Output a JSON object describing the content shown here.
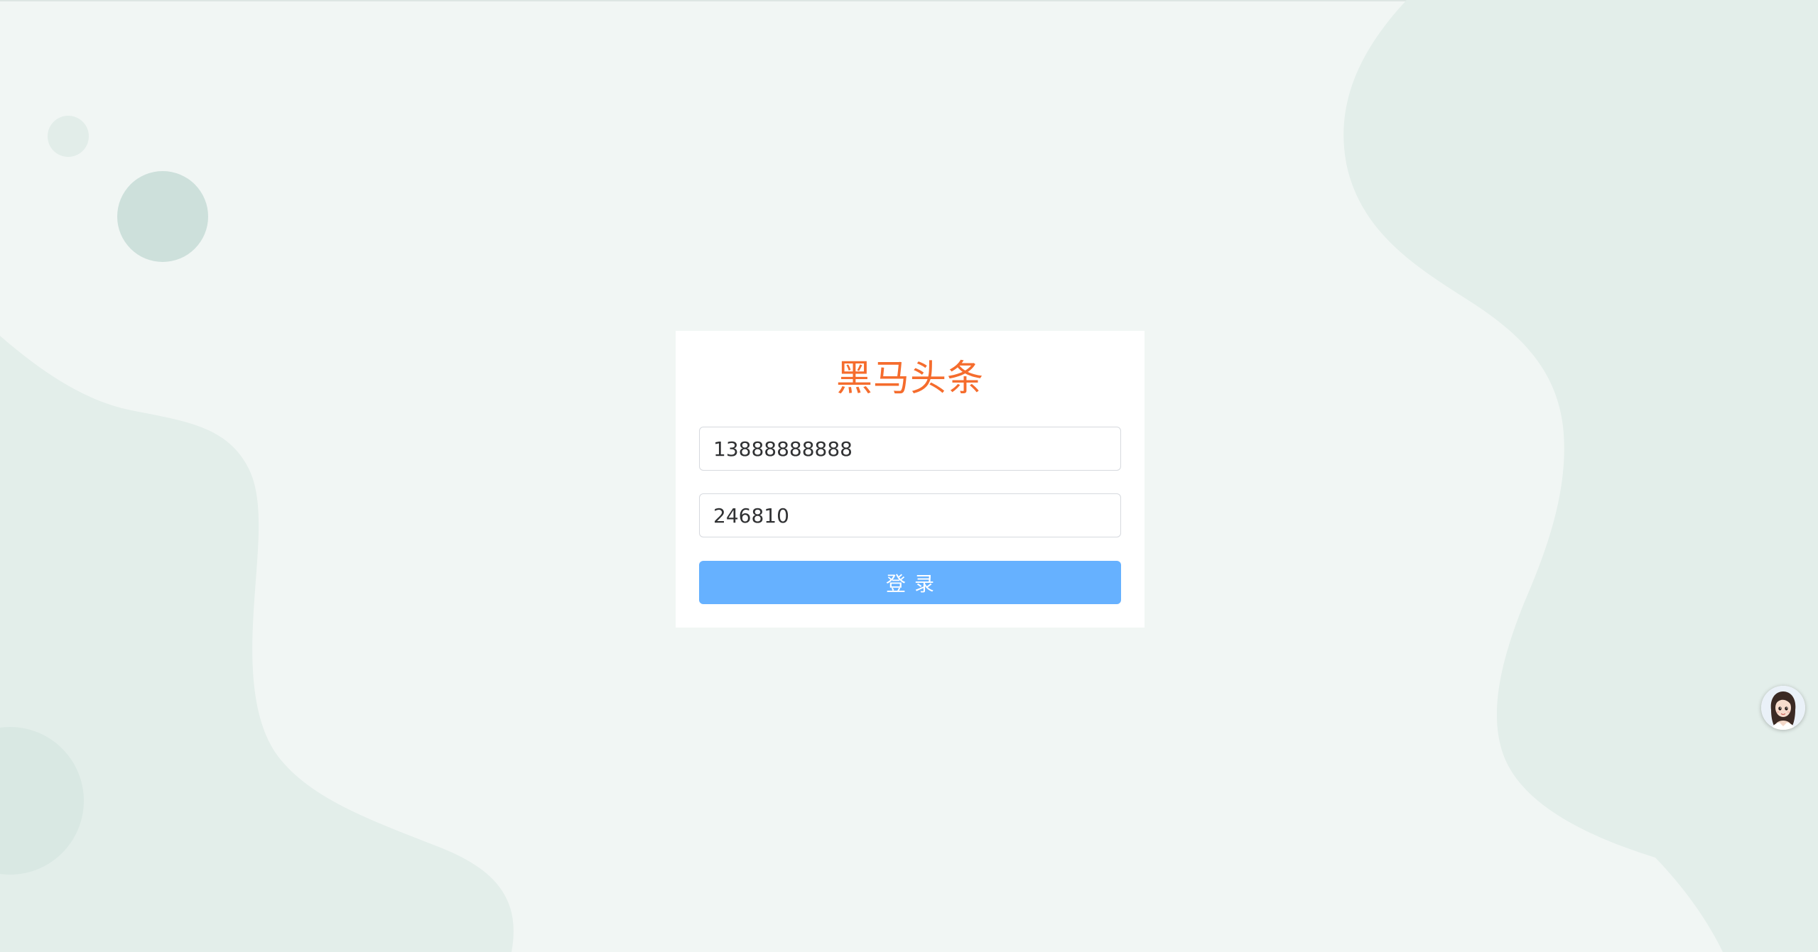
{
  "app": {
    "title": "黑马头条"
  },
  "form": {
    "phone": {
      "value": "13888888888"
    },
    "code": {
      "value": "246810"
    },
    "submit_label": "登录"
  },
  "assistant": {
    "icon": "assistant-avatar-icon"
  },
  "colors": {
    "page_background": "#f1f6f4",
    "background_shape": "#e3eeea",
    "background_circle": "#cde0db",
    "title": "#f56c2d",
    "button": "#66b1ff",
    "button_text": "#ffffff"
  }
}
